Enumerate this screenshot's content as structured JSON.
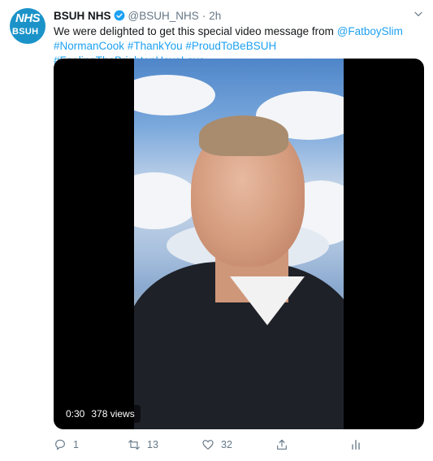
{
  "account": {
    "avatar_line1": "NHS",
    "avatar_line2": "BSUH",
    "name": "BSUH NHS",
    "handle": "@BSUH_NHS",
    "separator": "·",
    "time": "2h"
  },
  "tweet": {
    "text_before_mention": "We were delighted to get this special video message from ",
    "mention": "@FatboySlim",
    "hashtags": [
      "#NormanCook",
      "#ThankYou",
      "#ProudToBeBSUH",
      "#FeelingTheBrightonHoveLove"
    ]
  },
  "video": {
    "duration": "0:30",
    "views": "378 views"
  },
  "actions": {
    "reply_count": "1",
    "retweet_count": "13",
    "like_count": "32"
  },
  "colors": {
    "link": "#1da1f2",
    "muted": "#657786",
    "avatar_bg": "#1b93c9"
  },
  "icons": [
    "verified-badge-icon",
    "chevron-down-icon",
    "reply-icon",
    "retweet-icon",
    "like-icon",
    "share-icon",
    "analytics-icon"
  ]
}
